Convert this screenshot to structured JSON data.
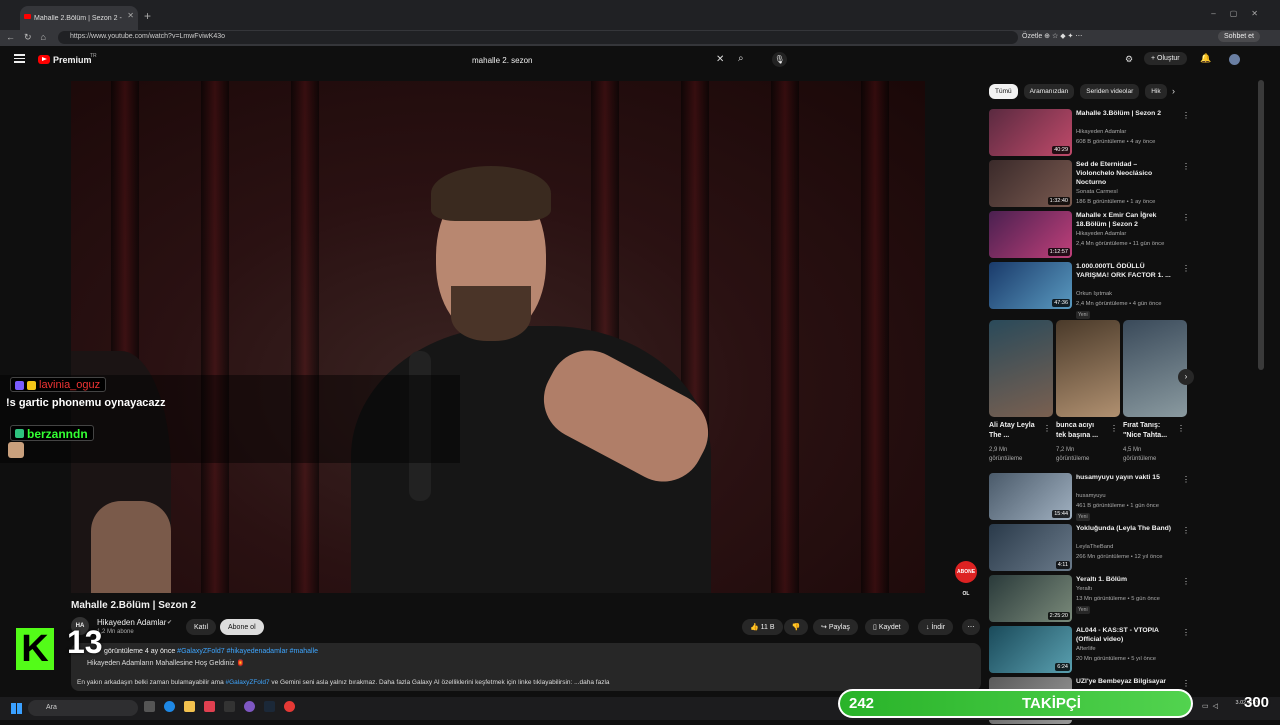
{
  "browser": {
    "tab_title": "Mahalle 2.Bölüm | Sezon 2 - YouTube",
    "url": "https://www.youtube.com/watch?v=LmwFviwK43o",
    "ozetle": "Özetle",
    "sohbet": "Sohbet et"
  },
  "yt": {
    "logo_text": "Premium",
    "logo_sup": "TR",
    "search_value": "mahalle 2. sezon",
    "create_label": "Oluştur"
  },
  "chat": [
    {
      "user": "lavinia_oguz",
      "message": "!s gartic phonemu oynayacazz",
      "color": "#e33333"
    },
    {
      "user": "berzanndn",
      "message": "",
      "color": "#33ff33"
    }
  ],
  "video": {
    "title": "Mahalle 2.Bölüm | Sezon 2",
    "channel": "Hikayeden Adamlar",
    "channel_avatar": "HA",
    "subscribers": "1,2 Mn abone",
    "join_label": "Katıl",
    "subscribe_label": "Abone ol",
    "likes": "11 B",
    "share_label": "Paylaş",
    "save_label": "Kaydet",
    "download_label": "İndir",
    "watermark": "ABONE OL",
    "desc_meta": "görüntüleme  4 ay önce",
    "desc_tags": "#GalaxyZFold7 #hikayedenadamlar #mahalle",
    "desc_line1": "Hikayeden Adamların Mahallesine Hoş Geldiniz 🏮",
    "desc_line2_a": "En yakın arkadaşın belki zaman bulamayabilir ama ",
    "desc_line2_tag": "#GalaxyZFold7",
    "desc_line2_b": " ve Gemini seni asla yalnız bırakmaz. Daha fazla Galaxy AI özelliklerini keşfetmek için linke tıklayabilirsin:  ...daha fazla"
  },
  "overlay": {
    "kick_letter": "K",
    "kick_number": "13",
    "follower_count": "242",
    "follower_label": "TAKİPÇİ",
    "follower_goal": "300"
  },
  "sidebar": {
    "chips": [
      "Tümü",
      "Aramanızdan",
      "Seriden videolar",
      "Hik"
    ],
    "recs": [
      {
        "title": "Mahalle 3.Bölüm | Sezon 2",
        "channel": "Hikayeden Adamlar",
        "meta": "608 B görüntüleme • 4 ay önce",
        "dur": "40:29",
        "c1": "#5a2a40",
        "c2": "#c04a6a",
        "yeni": ""
      },
      {
        "title": "Sed de Eternidad – Violonchelo Neoclásico Nocturno",
        "channel": "Sonata Carmesí",
        "meta": "186 B görüntüleme • 1 ay önce",
        "dur": "1:32:40",
        "c1": "#3a2a2a",
        "c2": "#7a5a50",
        "yeni": ""
      },
      {
        "title": "Mahalle x Emir Can İğrek 18.Bölüm | Sezon 2",
        "channel": "Hikayeden Adamlar",
        "meta": "2,4 Mn görüntüleme • 11 gün önce",
        "dur": "1:12:57",
        "c1": "#4a2050",
        "c2": "#c0407a",
        "yeni": ""
      },
      {
        "title": "1.000.000TL ÖDÜLLÜ YARIŞMA! ORK FACTOR 1. ...",
        "channel": "Orkun Işıtmak",
        "meta": "2,4 Mn görüntüleme • 4 gün önce",
        "dur": "47:36",
        "c1": "#1a3a6a",
        "c2": "#5a9ac0",
        "yeni": "Yeni"
      },
      {
        "title": "husamyuyu yayın vakti 15",
        "channel": "husamyuyu",
        "meta": "461 B görüntüleme • 1 gün önce",
        "dur": "15:44",
        "c1": "#4a5a6a",
        "c2": "#a0b0c0",
        "yeni": "Yeni"
      },
      {
        "title": "Yokluğunda (Leyla The Band)",
        "channel": "LeylaTheBand",
        "meta": "266 Mn görüntüleme • 12 yıl önce",
        "dur": "4:11",
        "c1": "#2a3a4a",
        "c2": "#6a7a8a",
        "yeni": ""
      },
      {
        "title": "Yeraltı 1. Bölüm",
        "channel": "Yeraltı",
        "meta": "13 Mn görüntüleme • 5 gün önce",
        "dur": "2:25:20",
        "c1": "#2a3a3a",
        "c2": "#7a8a7a",
        "yeni": "Yeni"
      },
      {
        "title": "AL044 - KAS:ST - VTOPIA (Official video)",
        "channel": "Afterlife",
        "meta": "20 Mn görüntüleme • 5 yıl önce",
        "dur": "6:24",
        "c1": "#1a4a5a",
        "c2": "#5aa0b0",
        "yeni": ""
      },
      {
        "title": "UZI'ye Bembeyaz Bilgisayar",
        "channel": "",
        "meta": "",
        "dur": "",
        "c1": "#5a5a5a",
        "c2": "#9a9a9a",
        "yeni": ""
      }
    ],
    "shorts": [
      {
        "title": "Ali Atay Leyla The ...",
        "meta": "2,9 Mn görüntüleme",
        "c1": "#2a4a5a",
        "c2": "#7a6050"
      },
      {
        "title": "bunca acıyı tek başına ...",
        "meta": "7,2 Mn görüntüleme",
        "c1": "#4a3a2a",
        "c2": "#b09070"
      },
      {
        "title": "Fırat Tanış: \"Nice Tahta...",
        "meta": "4,5 Mn görüntüleme",
        "c1": "#3a4a5a",
        "c2": "#8a9aa0"
      }
    ]
  },
  "taskbar": {
    "search": "Ara",
    "time": "",
    "date": "3.02.2026"
  }
}
